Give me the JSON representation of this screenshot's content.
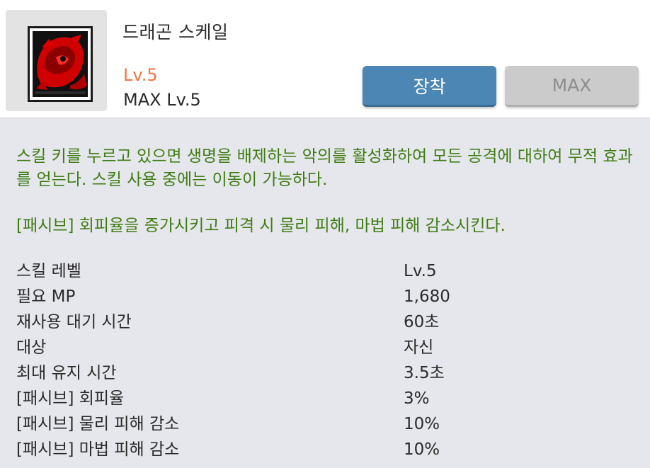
{
  "skill": {
    "name": "드래곤 스케일",
    "icon": "dragon-scale-icon",
    "level": "Lv.5",
    "max_level": "MAX Lv.5"
  },
  "buttons": {
    "equip_label": "장착",
    "max_label": "MAX"
  },
  "description": {
    "main": "스킬 키를 누르고 있으면 생명을 배제하는 악의를 활성화하여 모든 공격에 대하여 무적 효과를 얻는다. 스킬 사용 중에는 이동이 가능하다.",
    "passive": "[패시브] 회피율을 증가시키고 피격 시 물리 피해, 마법 피해 감소시킨다."
  },
  "stats": [
    {
      "label": "스킬 레벨",
      "value": "Lv.5"
    },
    {
      "label": "필요 MP",
      "value": "1,680"
    },
    {
      "label": "재사용 대기 시간",
      "value": "60초"
    },
    {
      "label": "대상",
      "value": "자신"
    },
    {
      "label": "최대 유지 시간",
      "value": "3.5초"
    },
    {
      "label": "[패시브] 회피율",
      "value": "3%"
    },
    {
      "label": "[패시브] 물리 피해 감소",
      "value": "10%"
    },
    {
      "label": "[패시브] 마법 피해 감소",
      "value": "10%"
    }
  ],
  "colors": {
    "level": "#f2733f",
    "description": "#3e7c12",
    "equip_button": "#4b86b4",
    "max_button": "#cbcbcb"
  }
}
